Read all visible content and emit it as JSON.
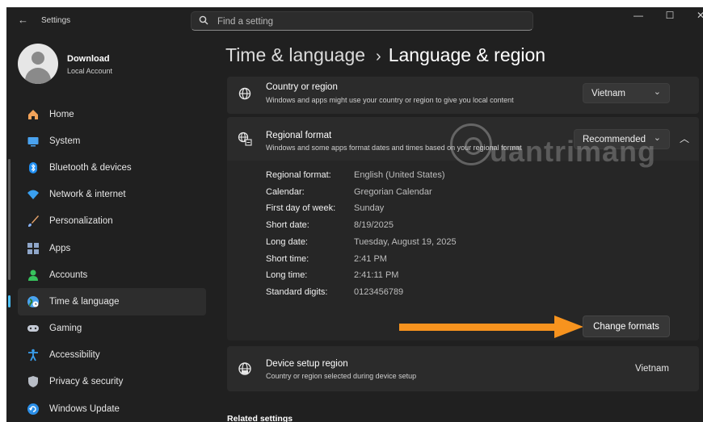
{
  "window": {
    "app_title": "Settings",
    "back_glyph": "←",
    "controls": {
      "minimize": "—",
      "maximize": "☐",
      "close": "✕"
    }
  },
  "search": {
    "placeholder": "Find a setting",
    "icon": "search-icon"
  },
  "user": {
    "name": "Download",
    "account_type": "Local Account"
  },
  "nav": [
    {
      "label": "Home",
      "icon": "home-icon",
      "color": "#f2a35a",
      "active": false
    },
    {
      "label": "System",
      "icon": "system-icon",
      "color": "#4aa3f0",
      "active": false
    },
    {
      "label": "Bluetooth & devices",
      "icon": "bluetooth-icon",
      "color": "#1f8ef1",
      "active": false
    },
    {
      "label": "Network & internet",
      "icon": "wifi-icon",
      "color": "#3aa0f0",
      "active": false
    },
    {
      "label": "Personalization",
      "icon": "brush-icon",
      "color": "#e6a36b",
      "active": false
    },
    {
      "label": "Apps",
      "icon": "apps-icon",
      "color": "#8fa6c9",
      "active": false
    },
    {
      "label": "Accounts",
      "icon": "accounts-icon",
      "color": "#37c35d",
      "active": false
    },
    {
      "label": "Time & language",
      "icon": "globe-clock-icon",
      "color": "#4aa3f0",
      "active": true
    },
    {
      "label": "Gaming",
      "icon": "gamepad-icon",
      "color": "#c5cbd6",
      "active": false
    },
    {
      "label": "Accessibility",
      "icon": "accessibility-icon",
      "color": "#3aa0f0",
      "active": false
    },
    {
      "label": "Privacy & security",
      "icon": "shield-icon",
      "color": "#b9bec7",
      "active": false
    },
    {
      "label": "Windows Update",
      "icon": "update-icon",
      "color": "#2b8fe8",
      "active": false
    }
  ],
  "breadcrumb": {
    "parent": "Time & language",
    "separator": "›",
    "current": "Language & region"
  },
  "country": {
    "title": "Country or region",
    "subtitle": "Windows and apps might use your country or region to give you local content",
    "value": "Vietnam",
    "icon": "globe-icon"
  },
  "regional_format": {
    "title": "Regional format",
    "subtitle": "Windows and some apps format dates and times based on your regional format",
    "value": "Recommended",
    "icon": "regional-format-icon",
    "expanded": true,
    "rows": [
      {
        "label": "Regional format:",
        "value": "English (United States)"
      },
      {
        "label": "Calendar:",
        "value": "Gregorian Calendar"
      },
      {
        "label": "First day of week:",
        "value": "Sunday"
      },
      {
        "label": "Short date:",
        "value": "8/19/2025"
      },
      {
        "label": "Long date:",
        "value": "Tuesday, August 19, 2025"
      },
      {
        "label": "Short time:",
        "value": "2:41 PM"
      },
      {
        "label": "Long time:",
        "value": "2:41:11 PM"
      },
      {
        "label": "Standard digits:",
        "value": "0123456789"
      }
    ],
    "change_button": "Change formats",
    "annotation_arrow_color": "#f7931e"
  },
  "device_region": {
    "title": "Device setup region",
    "subtitle": "Country or region selected during device setup",
    "value": "Vietnam",
    "icon": "globe-device-icon"
  },
  "related_settings": {
    "heading": "Related settings"
  },
  "watermark": {
    "text": "uantrimang"
  },
  "colors": {
    "accent": "#4cc2ff",
    "background": "#202020",
    "card": "#2b2b2b"
  }
}
